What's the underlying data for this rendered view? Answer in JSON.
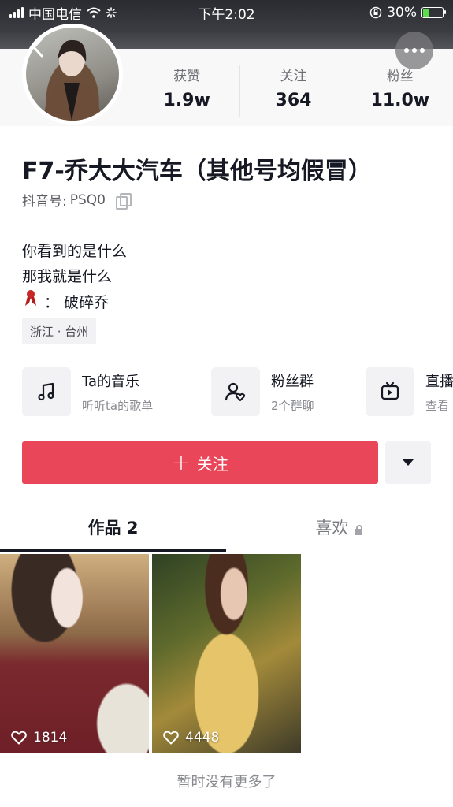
{
  "status_bar": {
    "carrier": "中国电信",
    "time": "下午2:02",
    "battery": "30%",
    "battery_level": 0.3
  },
  "header": {
    "back_icon": "chevron-left-icon",
    "more_icon": "ellipsis-icon"
  },
  "stats": [
    {
      "label": "获赞",
      "value": "1.9w"
    },
    {
      "label": "关注",
      "value": "364"
    },
    {
      "label": "粉丝",
      "value": "11.0w"
    }
  ],
  "profile": {
    "name": "F7-乔大大汽车（其他号均假冒）",
    "id_label": "抖音号: ",
    "id_value": "PSQ0",
    "bio": [
      "你看到的是什么",
      "那我就是什么",
      "：  破碎乔"
    ],
    "bio_emoji": "ribbon-icon",
    "location": "浙江 · 台州"
  },
  "shortcuts": [
    {
      "icon": "music-note-icon",
      "title": "Ta的音乐",
      "subtitle": "听听ta的歌单"
    },
    {
      "icon": "fan-group-icon",
      "title": "粉丝群",
      "subtitle": "2个群聊"
    },
    {
      "icon": "tv-live-icon",
      "title": "直播",
      "subtitle": "查看"
    }
  ],
  "actions": {
    "follow_plus": "+",
    "follow_label": "关注",
    "follow_color": "#ea4659"
  },
  "tabs": [
    {
      "label": "作品 2",
      "active": true
    },
    {
      "label": "喜欢",
      "active": false,
      "locked": true
    }
  ],
  "videos": [
    {
      "likes": "1814"
    },
    {
      "likes": "4448"
    }
  ],
  "footer": {
    "text": "暂时没有更多了"
  }
}
